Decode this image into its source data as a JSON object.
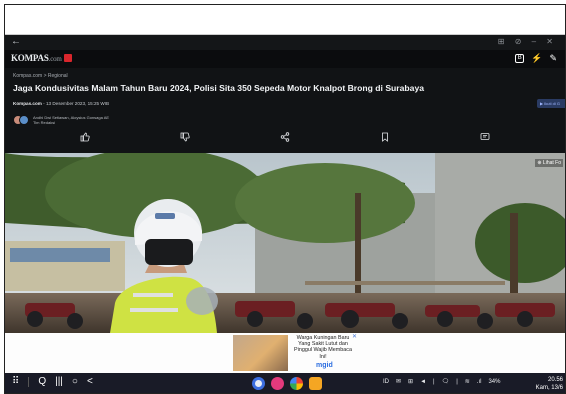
{
  "browser": {
    "back_label": "←",
    "window_controls": "⊞ ⊘ – ✕",
    "site_icons": [
      "B",
      "⚡",
      "✎"
    ]
  },
  "site": {
    "logo": "KOMPAS",
    "logo_tld": ".com",
    "breadcrumb": "Kompas.com > Regional",
    "headline": "Jaga Kondusivitas Malam Tahun Baru 2024, Polisi Sita 350 Sepeda Motor Knalpot Brong di Surabaya",
    "source": "Kompas.com",
    "date": "- 13 Desember 2023, 15:25 WIB",
    "follow_label": "▶ Ikuti di G",
    "authors": "Andhi Dwi Setiawan, Aloysius Gonsaga AE",
    "author_role": "Tim Redaksi"
  },
  "actions": [
    "like",
    "dislike",
    "share",
    "bookmark",
    "comment"
  ],
  "hero": {
    "full_image_label": "⊕ Lihat Fo"
  },
  "ad": {
    "text": "Warga Kuningan Baru Yang Sakit Lutut dan Pinggul Wajib Membaca Ini!",
    "brand": "mgid",
    "close_label": "✕"
  },
  "taskbar": {
    "nav_icons": [
      "⠿",
      "Q",
      "|||",
      "○",
      "<"
    ],
    "status_icons": [
      "ID",
      "✉",
      "⊞",
      "◄",
      "|",
      "🗨",
      "|",
      "≋"
    ],
    "signal": ".ıl",
    "battery": "34%",
    "time": "20.56",
    "date": "Kam, 13/6"
  },
  "colors": {
    "browser_bg": "#111315",
    "taskbar_bg": "#191b27",
    "brand_red": "#d9262c",
    "ad_link": "#2b6de0"
  }
}
